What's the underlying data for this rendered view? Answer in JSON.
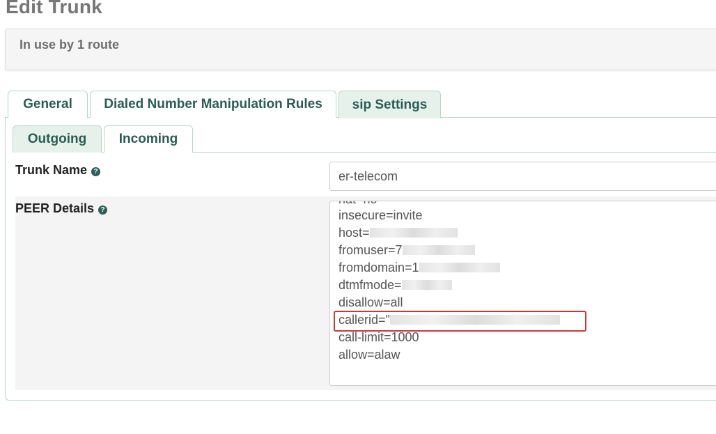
{
  "page": {
    "title": "Edit Trunk",
    "usage_note": "In use by 1 route"
  },
  "main_tabs": [
    {
      "label": "General",
      "active": false
    },
    {
      "label": "Dialed Number Manipulation Rules",
      "active": false
    },
    {
      "label": "sip Settings",
      "active": true
    }
  ],
  "sub_tabs": [
    {
      "label": "Outgoing",
      "active": true
    },
    {
      "label": "Incoming",
      "active": false
    }
  ],
  "form": {
    "trunk_name": {
      "label": "Trunk Name",
      "value": "er-telecom",
      "help_icon": "question-circle-icon"
    },
    "peer_details": {
      "label": "PEER Details",
      "help_icon": "question-circle-icon",
      "lines": [
        "nat=no",
        "insecure=invite",
        "host=",
        "fromuser=7",
        "fromdomain=1",
        "dtmfmode=",
        "disallow=all",
        "callerid=\"",
        "call-limit=1000",
        "allow=alaw"
      ],
      "highlighted_line": "callerid=\""
    }
  },
  "colors": {
    "title_gray": "#777777",
    "tab_text": "#2a5d53",
    "tab_border": "#b9d6c9",
    "active_tab_bg": "#e6f1ec",
    "highlight_red": "#c9393a"
  }
}
